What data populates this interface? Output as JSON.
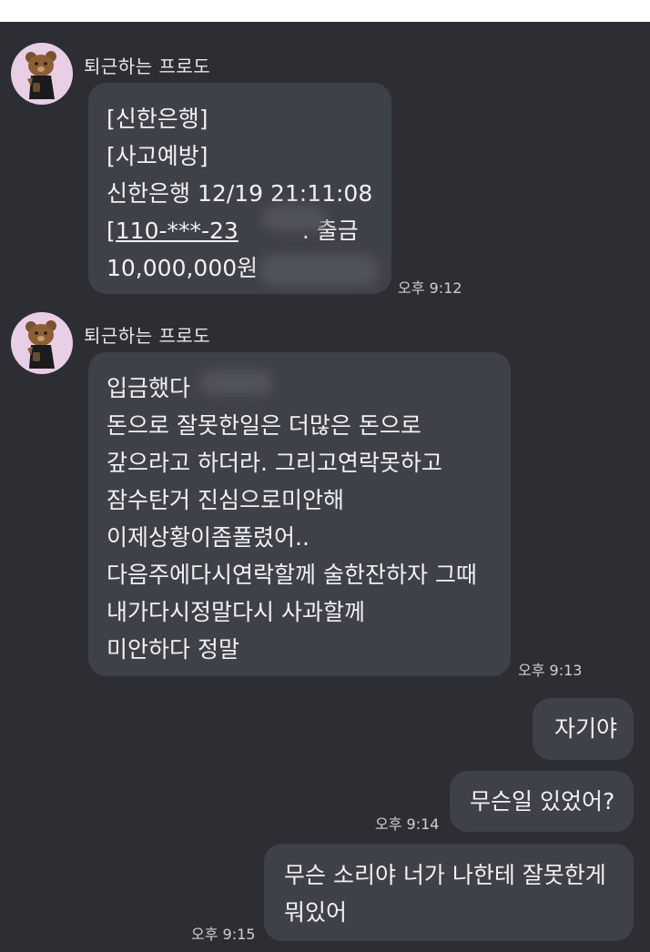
{
  "messages": [
    {
      "sender": "퇴근하는 프로도",
      "lines": [
        "[신한은행]",
        "[사고예방]",
        "신한은행 12/19 21:11:08",
        "[110-***-23",
        "10,000,000원"
      ],
      "trailing_text": ". 출금",
      "time": "오후 9:12"
    },
    {
      "sender": "퇴근하는 프로도",
      "lines": [
        "입금했다",
        "돈으로 잘못한일은 더많은 돈으로",
        "갚으라고 하더라. 그리고연락못하고",
        "잠수탄거 진심으로미안해",
        "이제상황이좀풀렸어..",
        "다음주에다시연락할께 술한잔하자 그때",
        "내가다시정말다시 사과할께",
        "미안하다 정말"
      ],
      "time": "오후 9:13"
    },
    {
      "text": "자기야"
    },
    {
      "text": "무슨일 있었어?",
      "time": "오후 9:14"
    },
    {
      "lines": [
        "무슨 소리야 너가 나한테 잘못한게",
        "뭐있어"
      ],
      "time": "오후 9:15"
    }
  ],
  "colors": {
    "background": "#2c2e34",
    "bubble": "#3f4148",
    "text": "#f1f1f3",
    "avatar_bg": "#e9cfe6"
  },
  "icons": [
    "bear-avatar-icon"
  ]
}
